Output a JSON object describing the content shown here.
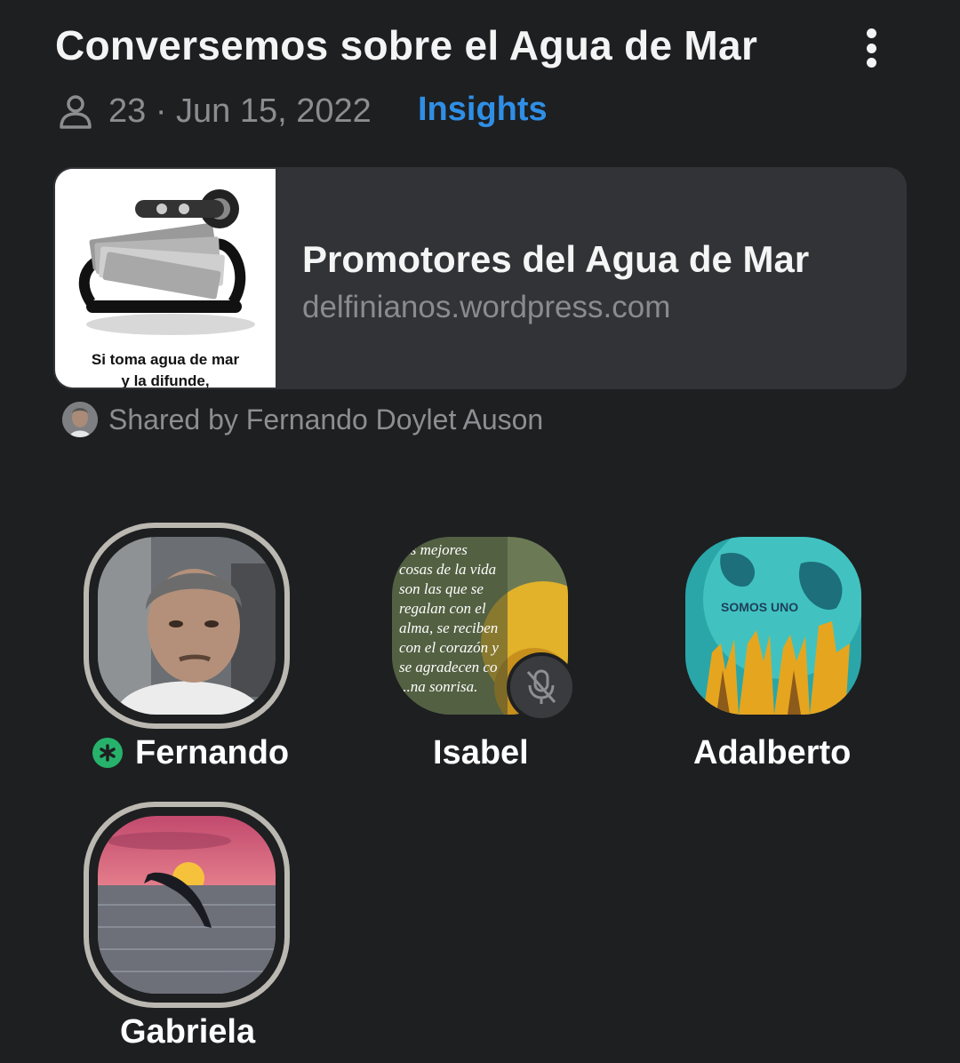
{
  "room": {
    "title": "Conversemos sobre el Agua de Mar",
    "meta": "23 · Jun 15, 2022",
    "insights_label": "Insights"
  },
  "icons": {
    "menu": "more-vertical-icon",
    "people": "person-icon",
    "muted": "mic-off-icon",
    "speaking": "asterisk-icon"
  },
  "link_card": {
    "title": "Promotores del Agua de Mar",
    "domain": "delfinianos.wordpress.com",
    "thumb_caption_line1": "Si toma agua de mar",
    "thumb_caption_line2": "y la difunde,"
  },
  "shared_by": "Shared by Fernando Doylet Auson",
  "speakers": [
    {
      "name": "Fernando",
      "speaking": true,
      "muted": false
    },
    {
      "name": "Isabel",
      "speaking": false,
      "muted": true
    },
    {
      "name": "Adalberto",
      "speaking": false,
      "muted": false
    },
    {
      "name": "Gabriela",
      "speaking": false,
      "muted": false
    }
  ],
  "avatar_text": {
    "isabel_quote": [
      "...s mejores",
      "cosas de la vida",
      "son las que se",
      "regalan con el",
      "alma, se reciben",
      "con el corazón y",
      "se agradecen co",
      "...na sonrisa."
    ],
    "adalberto_banner": "SOMOS UNO"
  },
  "colors": {
    "background": "#1e1f21",
    "card": "#323337",
    "accent": "#2f8fe6",
    "speaking_green": "#27b26b"
  }
}
